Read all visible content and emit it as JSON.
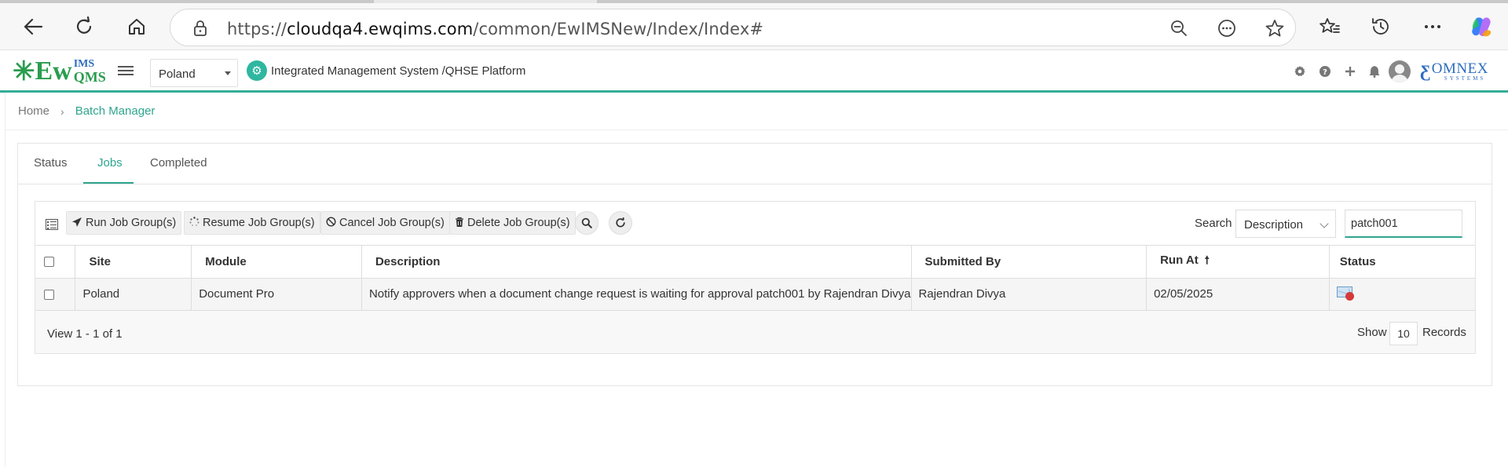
{
  "browser": {
    "url_prefix": "https://",
    "url_host": "cloudqa4.ewqims.com",
    "url_path": "/common/EwIMSNew/Index/Index#"
  },
  "app": {
    "logo": {
      "ew": "Ew",
      "ims": "IMS",
      "qms": "QMS"
    },
    "country": "Poland",
    "platform_title": "Integrated Management System /QHSE Platform",
    "company_logo": {
      "word": "OMNEX",
      "sub": "SYSTEMS"
    },
    "accent_color": "#35ad98"
  },
  "breadcrumb": {
    "home": "Home",
    "separator": "›",
    "current": "Batch Manager"
  },
  "tabs": [
    {
      "label": "Status",
      "active": false
    },
    {
      "label": "Jobs",
      "active": true
    },
    {
      "label": "Completed",
      "active": false
    }
  ],
  "toolbar": {
    "run": "Run Job Group(s)",
    "resume": "Resume Job Group(s)",
    "cancel": "Cancel Job Group(s)",
    "delete": "Delete Job Group(s)",
    "search_label": "Search",
    "search_field": "Description",
    "search_value": "patch001"
  },
  "table": {
    "columns": [
      "Site",
      "Module",
      "Description",
      "Submitted By",
      "Run At",
      "Status"
    ],
    "sort_indicator": "🠕",
    "rows": [
      {
        "site": "Poland",
        "module": "Document Pro",
        "description": "Notify approvers when a document change request is waiting for approval patch001 by Rajendran Divya",
        "submitted_by": "Rajendran Divya",
        "run_at": "02/05/2025",
        "status_icon": "mail-error-icon"
      }
    ]
  },
  "pager": {
    "view": "View 1 - 1 of 1",
    "show": "Show",
    "count": "10",
    "records": "Records"
  }
}
